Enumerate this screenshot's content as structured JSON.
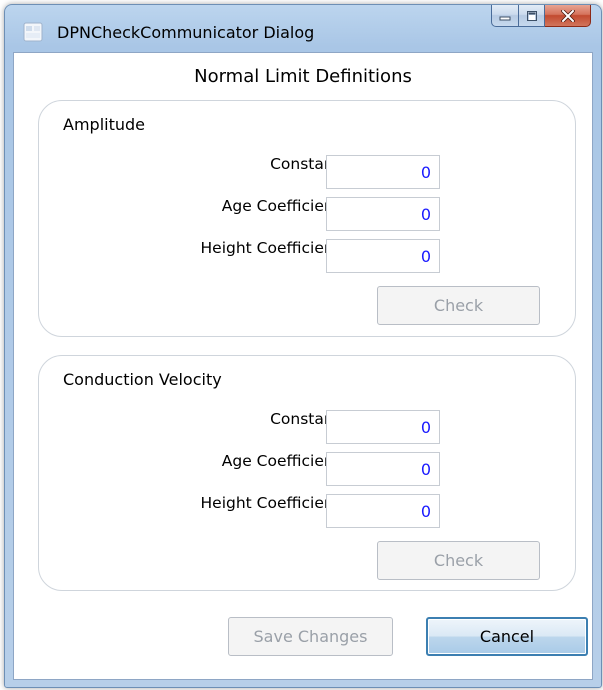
{
  "window": {
    "title": "DPNCheckCommunicator Dialog"
  },
  "main": {
    "heading": "Normal Limit Definitions"
  },
  "amplitude": {
    "title": "Amplitude",
    "constant_label": "Constant:",
    "constant_value": "0",
    "age_label": "Age Coefficient:",
    "age_value": "0",
    "height_label": "Height Coefficient:",
    "height_value": "0",
    "check_label": "Check"
  },
  "conduction_velocity": {
    "title": "Conduction Velocity",
    "constant_label": "Constant:",
    "constant_value": "0",
    "age_label": "Age Coefficient:",
    "age_value": "0",
    "height_label": "Height Coefficient:",
    "height_value": "0",
    "check_label": "Check"
  },
  "footer": {
    "save_label": "Save Changes",
    "cancel_label": "Cancel"
  },
  "colors": {
    "input_text": "#1a1aff",
    "disabled_text": "#9aa0a8",
    "default_button_border": "#3c7fb1",
    "close_button": "#c24a2f"
  },
  "icons": {
    "app": "app-icon",
    "minimize": "minimize-icon",
    "maximize": "maximize-icon",
    "close": "close-icon"
  }
}
